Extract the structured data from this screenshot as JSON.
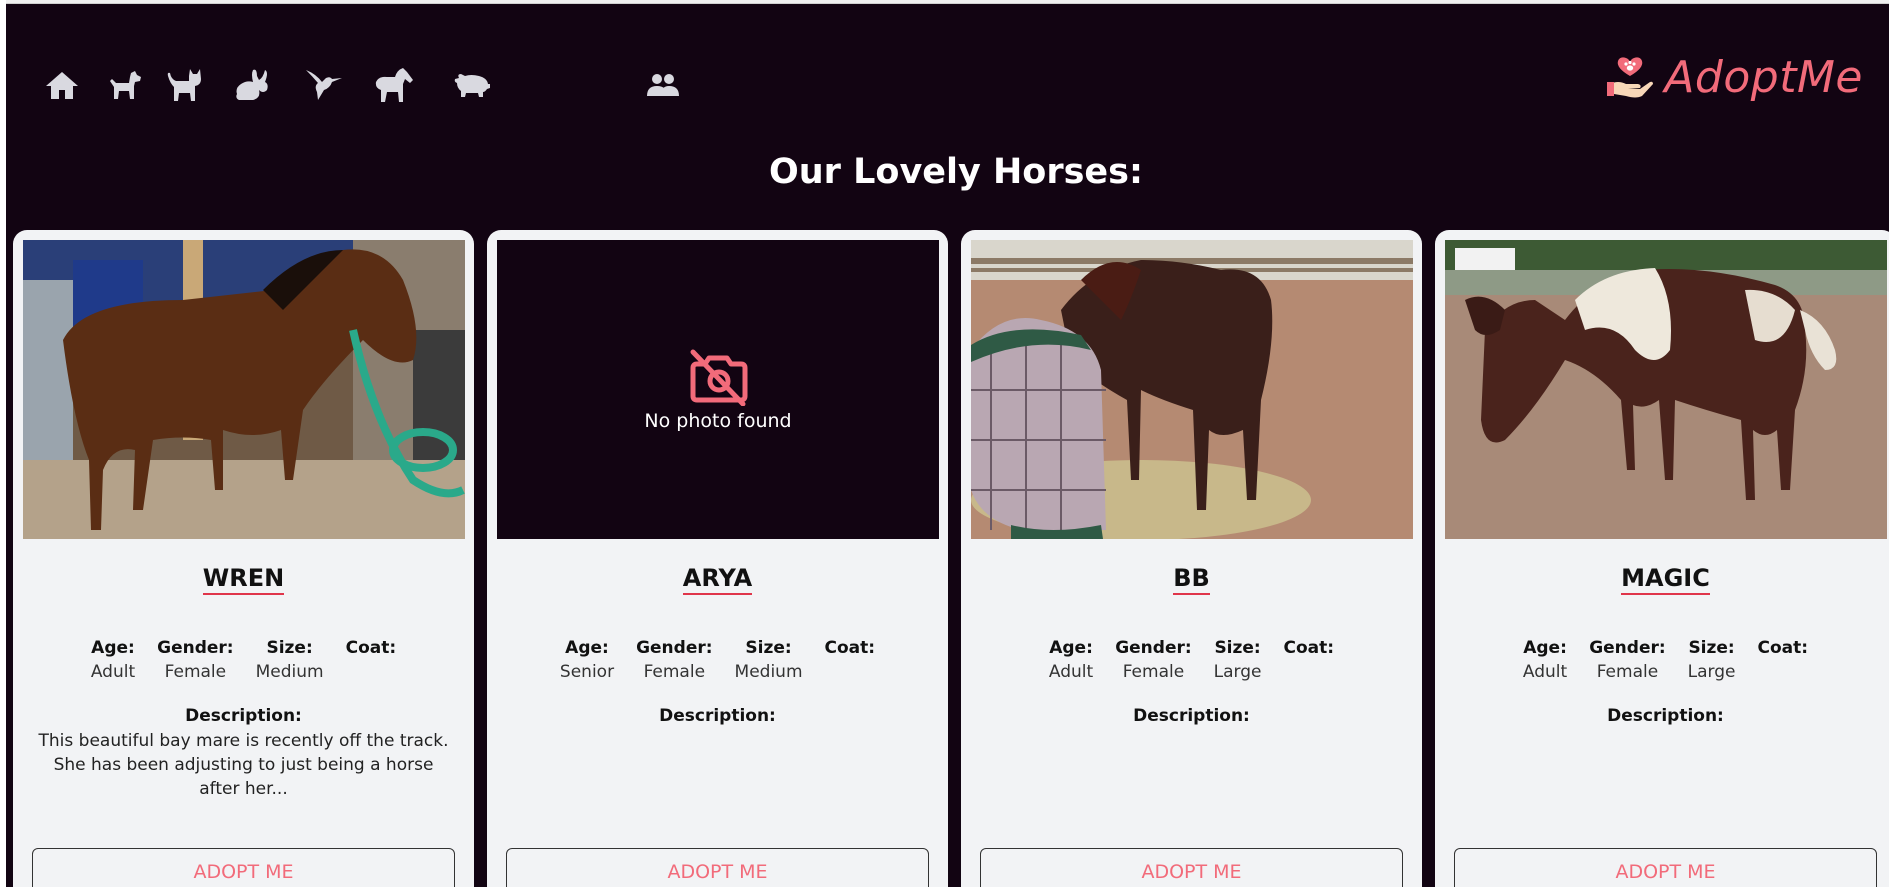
{
  "nav": {
    "items": [
      {
        "name": "home",
        "icon": "home-icon"
      },
      {
        "name": "dogs",
        "icon": "dog-icon"
      },
      {
        "name": "cats",
        "icon": "cat-icon"
      },
      {
        "name": "rabbits",
        "icon": "rabbit-icon"
      },
      {
        "name": "birds",
        "icon": "hummingbird-icon"
      },
      {
        "name": "horses",
        "icon": "horse-icon"
      },
      {
        "name": "barnyard",
        "icon": "pig-icon"
      },
      {
        "name": "team",
        "icon": "users-icon"
      }
    ],
    "brand": "AdoptMe",
    "brand_icon": "hand-heart-paw-icon"
  },
  "page": {
    "title": "Our Lovely Horses:"
  },
  "labels": {
    "age": "Age:",
    "gender": "Gender:",
    "size": "Size:",
    "coat": "Coat:",
    "description": "Description:",
    "adopt": "ADOPT ME",
    "no_photo": "No photo found"
  },
  "cards": [
    {
      "name": "WREN",
      "age": "Adult",
      "gender": "Female",
      "size": "Medium",
      "coat": "",
      "description": "This beautiful bay mare is recently off the track. She has been adjusting to just being a horse after her...",
      "photo": "bay-horse-photo"
    },
    {
      "name": "ARYA",
      "age": "Senior",
      "gender": "Female",
      "size": "Medium",
      "coat": "",
      "description": "",
      "photo": "none"
    },
    {
      "name": "BB",
      "age": "Adult",
      "gender": "Female",
      "size": "Large",
      "coat": "",
      "description": "",
      "photo": "dark-horse-fly-mask-photo"
    },
    {
      "name": "MAGIC",
      "age": "Adult",
      "gender": "Female",
      "size": "Large",
      "coat": "",
      "description": "",
      "photo": "pinto-horse-photo"
    }
  ],
  "colors": {
    "background": "#120412",
    "accent": "#f26b7a",
    "card": "#f2f3f5",
    "underline": "#e0354a"
  }
}
